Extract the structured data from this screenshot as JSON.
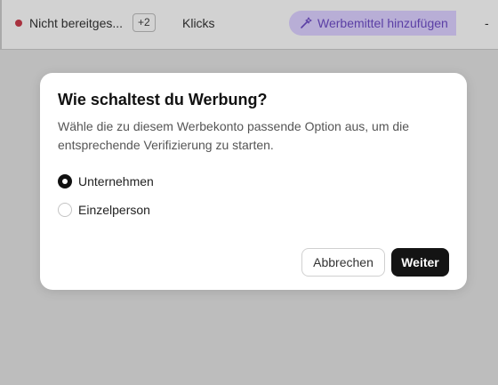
{
  "background": {
    "status_label": "Nicht bereitges...",
    "extra_count": "+2",
    "clicks_label": "Klicks",
    "add_ad_label": "Werbemittel hinzufügen",
    "trailing_value": "-",
    "status_color": "#a8323f",
    "accent_color": "#5b3fa5"
  },
  "modal": {
    "title": "Wie schaltest du Werbung?",
    "description": "Wähle die zu diesem Werbekonto passende Option aus, um die entsprechende Verifizierung zu starten.",
    "options": [
      {
        "label": "Unternehmen",
        "selected": true
      },
      {
        "label": "Einzelperson",
        "selected": false
      }
    ],
    "cancel_label": "Abbrechen",
    "next_label": "Weiter"
  }
}
